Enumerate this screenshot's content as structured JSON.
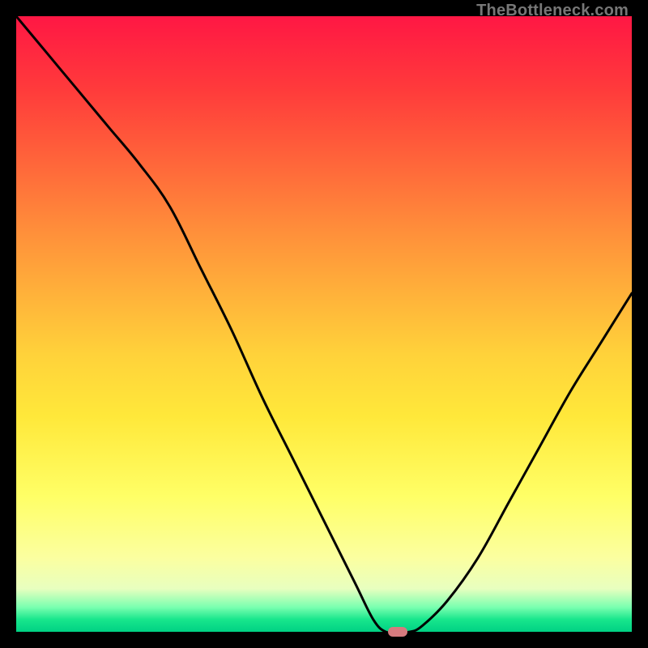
{
  "watermark": "TheBottleneck.com",
  "colors": {
    "frame": "#000000",
    "curve_stroke": "#000000",
    "marker_fill": "#d67a7e",
    "gradient_top": "#ff1744",
    "gradient_bottom": "#00d184"
  },
  "chart_data": {
    "type": "line",
    "title": "",
    "xlabel": "",
    "ylabel": "",
    "xlim": [
      0,
      100
    ],
    "ylim": [
      0,
      100
    ],
    "grid": false,
    "legend": false,
    "x": [
      0,
      5,
      10,
      15,
      20,
      25,
      30,
      35,
      40,
      45,
      50,
      55,
      58,
      60,
      62,
      64,
      66,
      70,
      75,
      80,
      85,
      90,
      95,
      100
    ],
    "values": [
      100,
      94,
      88,
      82,
      76,
      69,
      59,
      49,
      38,
      28,
      18,
      8,
      2,
      0,
      0,
      0,
      1,
      5,
      12,
      21,
      30,
      39,
      47,
      55
    ],
    "optimal_marker": {
      "x": 62,
      "y": 0
    },
    "note": "Values are read as percent of plot height from the bottom (green) baseline. Curve descends from upper-left, reaches minimum around x≈60–64, then rises toward the right."
  }
}
